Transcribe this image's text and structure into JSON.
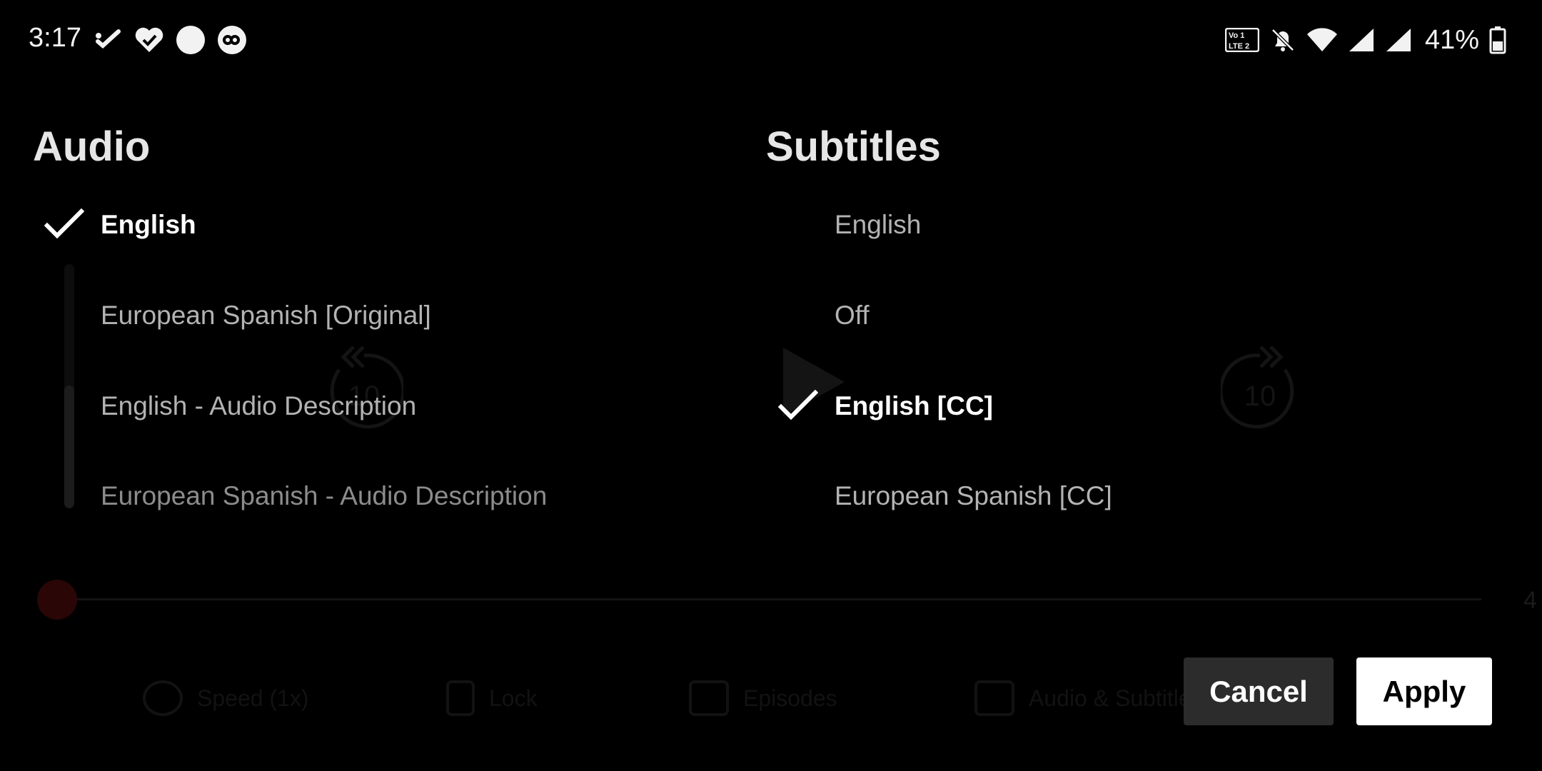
{
  "status_bar": {
    "time": "3:17",
    "notification_icons": [
      "check-tick-icon",
      "heart-check-icon",
      "circle-icon",
      "link-circle-icon"
    ],
    "system_icons": [
      "volte-icon",
      "bell-off-icon",
      "wifi-icon",
      "signal-icon",
      "signal-icon",
      "battery-icon"
    ],
    "battery_percent": "41%"
  },
  "player_background": {
    "rewind_label": "10",
    "forward_label": "10",
    "time_remaining": "4",
    "controls": [
      "Speed (1x)",
      "Lock",
      "Episodes",
      "Audio & Subtitles"
    ],
    "accent_color": "#e50914"
  },
  "audio": {
    "title": "Audio",
    "options": [
      {
        "label": "English",
        "selected": true
      },
      {
        "label": "European Spanish [Original]",
        "selected": false
      },
      {
        "label": "English - Audio Description",
        "selected": false
      },
      {
        "label": "European Spanish - Audio Description",
        "selected": false
      }
    ]
  },
  "subtitles": {
    "title": "Subtitles",
    "options": [
      {
        "label": "English",
        "selected": false
      },
      {
        "label": "Off",
        "selected": false
      },
      {
        "label": "English [CC]",
        "selected": true
      },
      {
        "label": "European Spanish [CC]",
        "selected": false
      }
    ]
  },
  "actions": {
    "cancel_label": "Cancel",
    "apply_label": "Apply"
  },
  "colors": {
    "background": "#000000",
    "selected_text": "#ffffff",
    "unselected_text": "#b3b3b3",
    "cancel_bg": "#2c2c2c",
    "apply_bg": "#ffffff"
  }
}
